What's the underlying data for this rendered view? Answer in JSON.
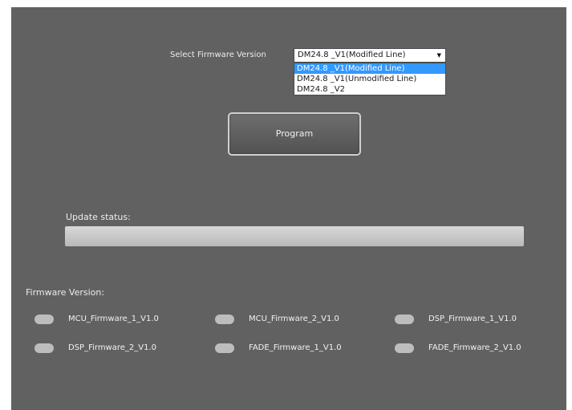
{
  "firmware_select": {
    "label": "Select Firmware Version",
    "selected": "DM24.8 _V1(Modified Line)",
    "options": [
      "DM24.8 _V1(Modified Line)",
      "DM24.8 _V1(Unmodified Line)",
      "DM24.8 _V2"
    ],
    "highlighted_index": 0
  },
  "program_button": {
    "label": "Program"
  },
  "update_status": {
    "label": "Update status:",
    "progress": 0
  },
  "firmware_versions": {
    "title": "Firmware Version:",
    "items": [
      "MCU_Firmware_1_V1.0",
      "MCU_Firmware_2_V1.0",
      "DSP_Firmware_1_V1.0",
      "DSP_Firmware_2_V1.0",
      "FADE_Firmware_1_V1.0",
      "FADE_Firmware_2_V1.0"
    ]
  },
  "colors": {
    "background": "#616161",
    "highlight": "#3399ff",
    "indicator": "#bdbdbd"
  },
  "icons": {
    "dropdown_arrow": "chevron-down-icon"
  }
}
